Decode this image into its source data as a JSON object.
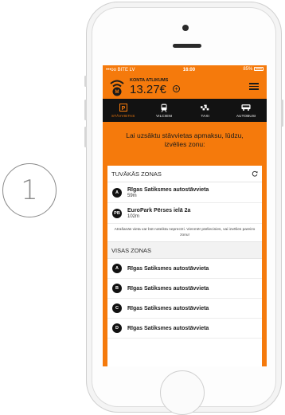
{
  "step_number": "1",
  "status_bar": {
    "carrier": "•••oo BITE LV",
    "time": "16:00",
    "battery": "85%"
  },
  "account": {
    "label": "KONTA ATLIKUMS",
    "amount": "13.27€"
  },
  "tabs": [
    {
      "label": "STĀVVIETAS",
      "icon": "parking-icon",
      "active": true
    },
    {
      "label": "VILCIENI",
      "icon": "train-icon",
      "active": false
    },
    {
      "label": "TAXI",
      "icon": "taxi-icon",
      "active": false
    },
    {
      "label": "AUTOBUSI",
      "icon": "bus-icon",
      "active": false
    }
  ],
  "prompt": "Lai uzsāktu stāvvietas apmaksu, lūdzu, izvēlies zonu:",
  "nearest": {
    "title": "TUVĀKĀS ZONAS",
    "items": [
      {
        "badge": "A",
        "name": "Rīgas Satiksmes autostāvvieta",
        "distance": "59m"
      },
      {
        "badge": "PB",
        "name": "EuroPark Pērses ielā 2a",
        "distance": "102m"
      }
    ],
    "note": "Atrašanās vieta var būt noteikta neprecīzi. Vienmēr pārliecinies, vai izvēlies pareizo zonu!"
  },
  "all": {
    "title": "VISAS ZONAS",
    "items": [
      {
        "badge": "A",
        "name": "Rīgas Satiksmes autostāvvieta"
      },
      {
        "badge": "B",
        "name": "Rīgas Satiksmes autostāvvieta"
      },
      {
        "badge": "C",
        "name": "Rīgas Satiksmes autostāvvieta"
      },
      {
        "badge": "D",
        "name": "Rīgas Satiksmes autostāvvieta"
      }
    ]
  },
  "colors": {
    "accent": "#f57a0c",
    "tabbar": "#121212"
  }
}
